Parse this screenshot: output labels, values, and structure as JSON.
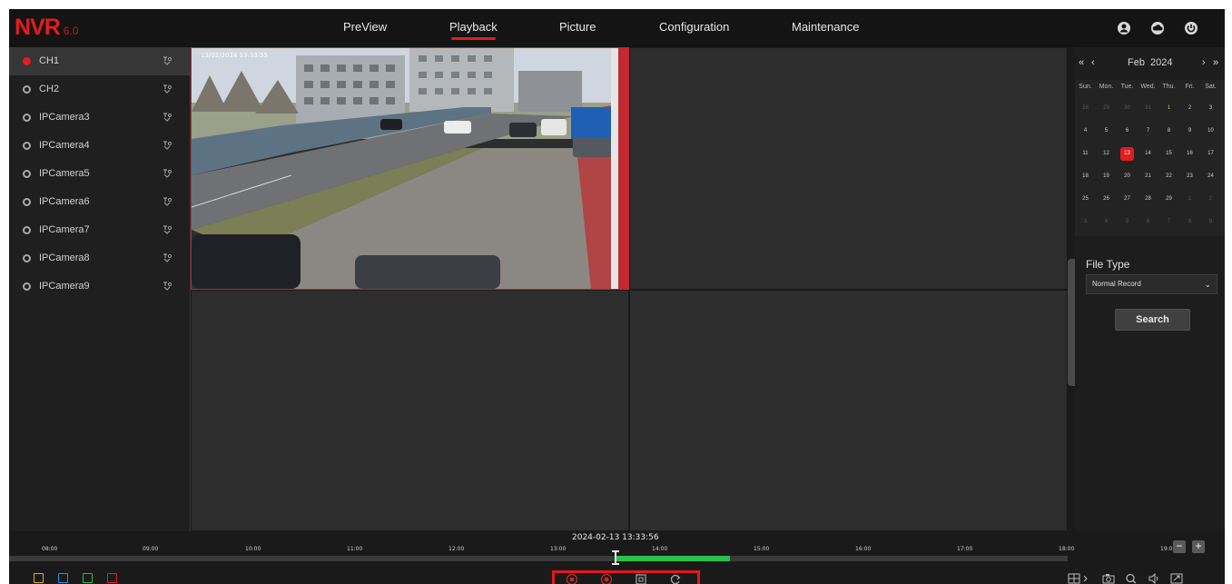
{
  "header": {
    "logo": "NVR",
    "logo_version": "6.0",
    "nav": [
      {
        "label": "PreView",
        "active": false
      },
      {
        "label": "Playback",
        "active": true
      },
      {
        "label": "Picture",
        "active": false
      },
      {
        "label": "Configuration",
        "active": false
      },
      {
        "label": "Maintenance",
        "active": false
      }
    ],
    "icons": [
      "user-icon",
      "cloud-icon",
      "power-icon"
    ]
  },
  "channels": [
    {
      "label": "CH1",
      "selected": true
    },
    {
      "label": "CH2",
      "selected": false
    },
    {
      "label": "IPCamera3",
      "selected": false
    },
    {
      "label": "IPCamera4",
      "selected": false
    },
    {
      "label": "IPCamera5",
      "selected": false
    },
    {
      "label": "IPCamera6",
      "selected": false
    },
    {
      "label": "IPCamera7",
      "selected": false
    },
    {
      "label": "IPCamera8",
      "selected": false
    },
    {
      "label": "IPCamera9",
      "selected": false
    }
  ],
  "video": {
    "timestamp": "13/02/2024 13:33:55"
  },
  "calendar": {
    "month_label": "Feb",
    "year_label": "2024",
    "prev_year": "«",
    "prev_month": "‹",
    "next_month": "›",
    "next_year": "»",
    "weekdays": [
      "Sun.",
      "Mon.",
      "Tue.",
      "Wed.",
      "Thu.",
      "Fri.",
      "Sat."
    ],
    "weeks": [
      [
        "28",
        "29",
        "30",
        "31",
        "1",
        "2",
        "3"
      ],
      [
        "4",
        "5",
        "6",
        "7",
        "8",
        "9",
        "10"
      ],
      [
        "11",
        "12",
        "13",
        "14",
        "15",
        "16",
        "17"
      ],
      [
        "18",
        "19",
        "20",
        "21",
        "22",
        "23",
        "24"
      ],
      [
        "25",
        "26",
        "27",
        "28",
        "29",
        "1",
        "2"
      ],
      [
        "3",
        "4",
        "5",
        "6",
        "7",
        "8",
        "9"
      ]
    ],
    "selected_day": "13"
  },
  "file_type": {
    "label": "File Type",
    "value": "Normal Record",
    "chevron": "⌄"
  },
  "search_label": "Search",
  "timeline": {
    "current_time": "2024-02-13 13:33:56",
    "ticks": [
      "08:00",
      "09:00",
      "10:00",
      "11:00",
      "12:00",
      "13:00",
      "14:00",
      "15:00",
      "16:00",
      "17:00",
      "18:00",
      "19:00"
    ],
    "zoom_out": "−",
    "zoom_in": "+"
  },
  "colors": {
    "accent": "#e11d1d",
    "record_bar": "#28c24a",
    "legend": [
      "#e0b020",
      "#2a8fe6",
      "#2bbd4a",
      "#e11d1d"
    ]
  }
}
